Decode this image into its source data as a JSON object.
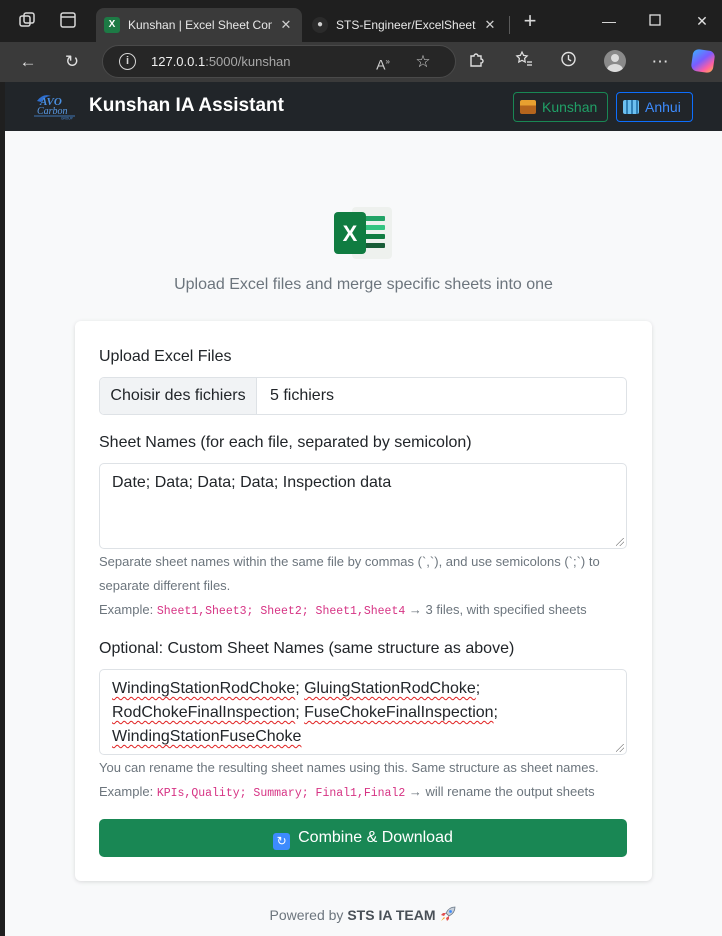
{
  "browser": {
    "tabs": [
      {
        "title": "Kunshan | Excel Sheet Comb",
        "icon": "excel-favicon",
        "active": true
      },
      {
        "title": "STS-Engineer/ExcelSheetCo",
        "icon": "github-favicon",
        "active": false
      }
    ],
    "address": {
      "host": "127.0.0.1",
      "path": ":5000/kunshan"
    }
  },
  "navbar": {
    "brand": "Kunshan IA Assistant",
    "logo_text": "Carbon",
    "buttons": [
      {
        "label": "Kunshan",
        "icon": "factory-icon",
        "color": "#198754"
      },
      {
        "label": "Anhui",
        "icon": "office-building-icon",
        "color": "#0d6efd"
      }
    ]
  },
  "hero": {
    "subtitle": "Upload Excel files and merge specific sheets into one"
  },
  "form": {
    "upload": {
      "label": "Upload Excel Files",
      "button": "Choisir des fichiers",
      "value": "5 fichiers"
    },
    "sheet_names": {
      "label": "Sheet Names (for each file, separated by semicolon)",
      "value": "Date; Data; Data; Data; Inspection data",
      "help_line1": "Separate sheet names within the same file by commas (`,`), and use semicolons (`;`) to",
      "help_line2": "separate different files.",
      "example_prefix": "Example: ",
      "example_code": "Sheet1,Sheet3; Sheet2; Sheet1,Sheet4",
      "example_suffix": " → 3 files, with specified sheets"
    },
    "custom_names": {
      "label": "Optional: Custom Sheet Names (same structure as above)",
      "lines": [
        [
          "WindingStationRodChoke",
          "; ",
          "GluingStationRodChoke",
          ";"
        ],
        [
          "RodChokeFinalInspection",
          "; ",
          "FuseChokeFinalInspection",
          ";"
        ],
        [
          "WindingStationFuseChoke"
        ]
      ],
      "help": "You can rename the resulting sheet names using this. Same structure as sheet names.",
      "example_prefix": "Example: ",
      "example_code": "KPIs,Quality; Summary; Final1,Final2",
      "example_suffix": " → will rename the output sheets"
    },
    "submit": {
      "label": "Combine & Download",
      "icon": "refresh-icon",
      "color": "#198754"
    }
  },
  "footer": {
    "prefix": "Powered by ",
    "team": "STS IA TEAM",
    "icon": "rocket-icon"
  }
}
